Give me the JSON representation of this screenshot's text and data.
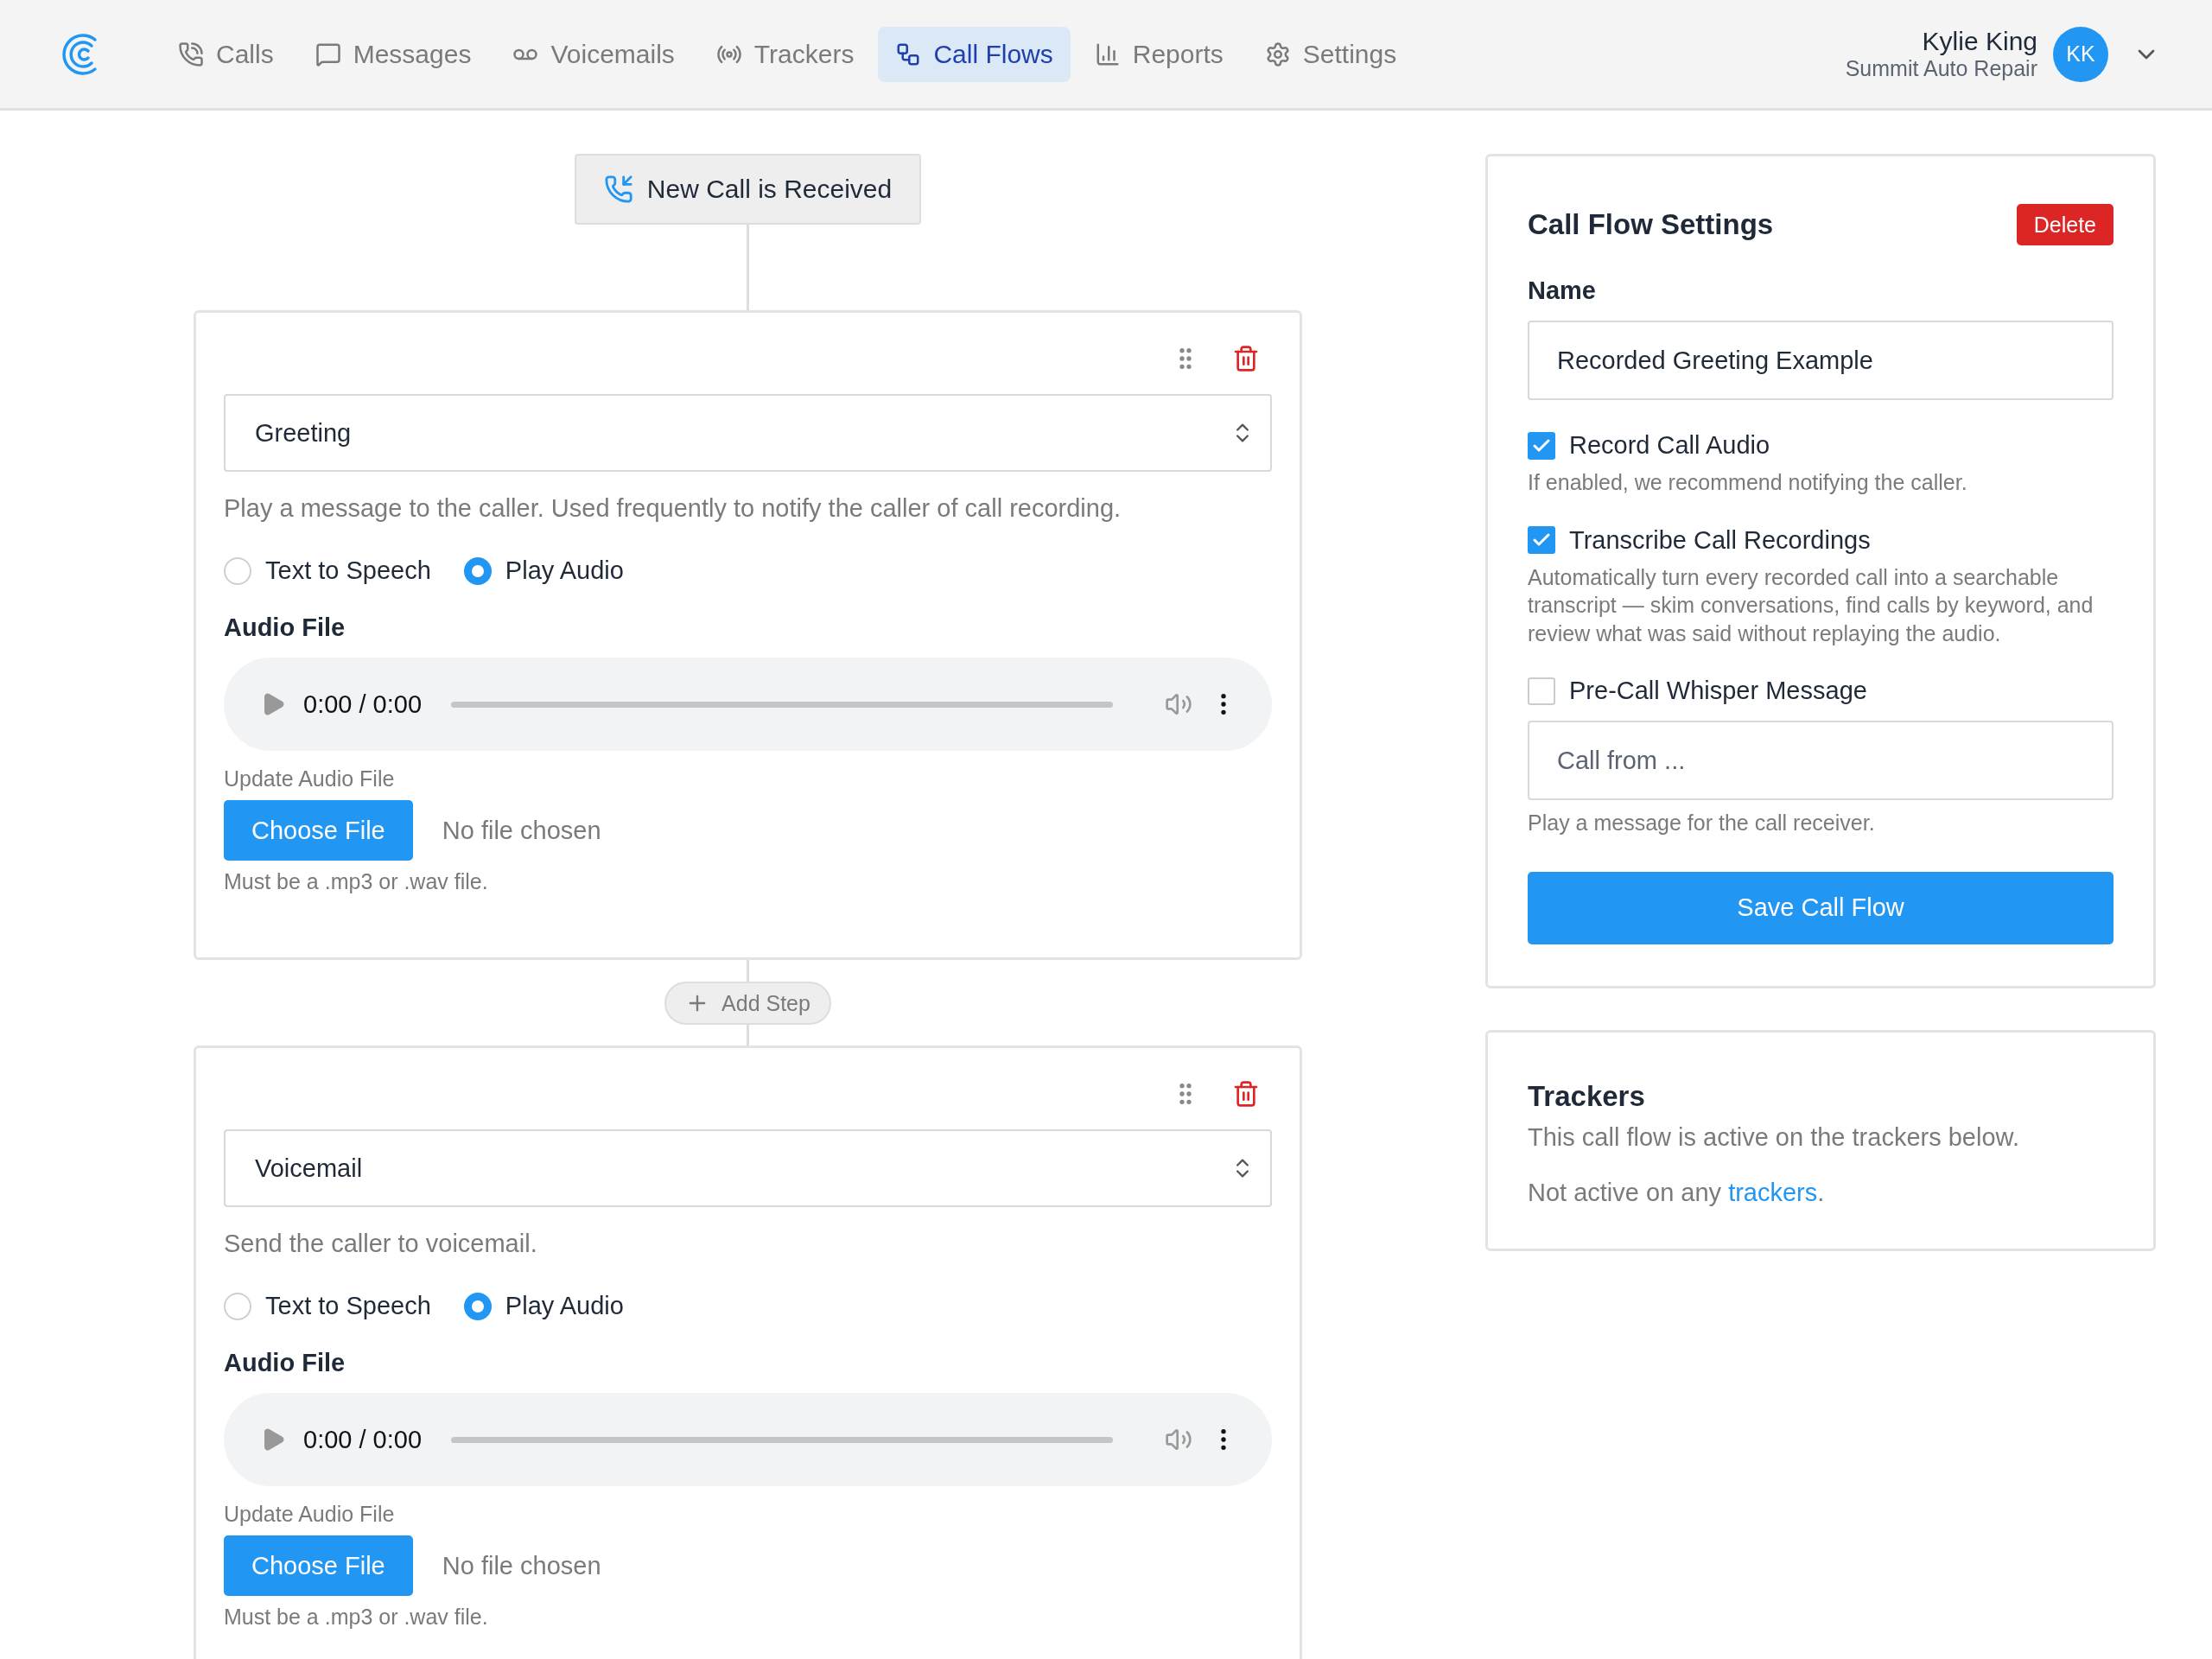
{
  "nav": {
    "items": [
      {
        "label": "Calls",
        "selected": false
      },
      {
        "label": "Messages",
        "selected": false
      },
      {
        "label": "Voicemails",
        "selected": false
      },
      {
        "label": "Trackers",
        "selected": false
      },
      {
        "label": "Call Flows",
        "selected": true
      },
      {
        "label": "Reports",
        "selected": false
      },
      {
        "label": "Settings",
        "selected": false
      }
    ]
  },
  "user": {
    "name": "Kylie King",
    "company": "Summit Auto Repair",
    "initials": "KK"
  },
  "trigger": {
    "label": "New Call is Received"
  },
  "steps": [
    {
      "type": "Greeting",
      "description": "Play a message to the caller. Used frequently to notify the caller of call recording.",
      "options": [
        {
          "label": "Text to Speech",
          "selected": false
        },
        {
          "label": "Play Audio",
          "selected": true
        }
      ],
      "audio_label": "Audio File",
      "player_time": "0:00 / 0:00",
      "update_label": "Update Audio File",
      "choose_button": "Choose File",
      "file_status": "No file chosen",
      "hint": "Must be a .mp3 or .wav file."
    },
    {
      "type": "Voicemail",
      "description": "Send the caller to voicemail.",
      "options": [
        {
          "label": "Text to Speech",
          "selected": false
        },
        {
          "label": "Play Audio",
          "selected": true
        }
      ],
      "audio_label": "Audio File",
      "player_time": "0:00 / 0:00",
      "update_label": "Update Audio File",
      "choose_button": "Choose File",
      "file_status": "No file chosen",
      "hint": "Must be a .mp3 or .wav file."
    }
  ],
  "add_step": "Add Step",
  "settings": {
    "title": "Call Flow Settings",
    "delete_button": "Delete",
    "name_label": "Name",
    "name_value": "Recorded Greeting Example",
    "options": [
      {
        "kind": "check",
        "label": "Record Call Audio",
        "checked": true,
        "help": "If enabled, we recommend notifying the caller."
      },
      {
        "kind": "check",
        "label": "Transcribe Call Recordings",
        "checked": true,
        "help": "Automatically turn every recorded call into a searchable transcript — skim conversations, find calls by keyword, and review what was said without replaying the audio."
      },
      {
        "kind": "check-field",
        "label": "Pre-Call Whisper Message",
        "checked": false,
        "placeholder": "Call from ...",
        "help": "Play a message for the call receiver."
      }
    ],
    "save_button": "Save Call Flow"
  },
  "trackers": {
    "title": "Trackers",
    "description": "This call flow is active on the trackers below.",
    "status_before": "Not active on any ",
    "status_link": "trackers",
    "status_after": "."
  }
}
